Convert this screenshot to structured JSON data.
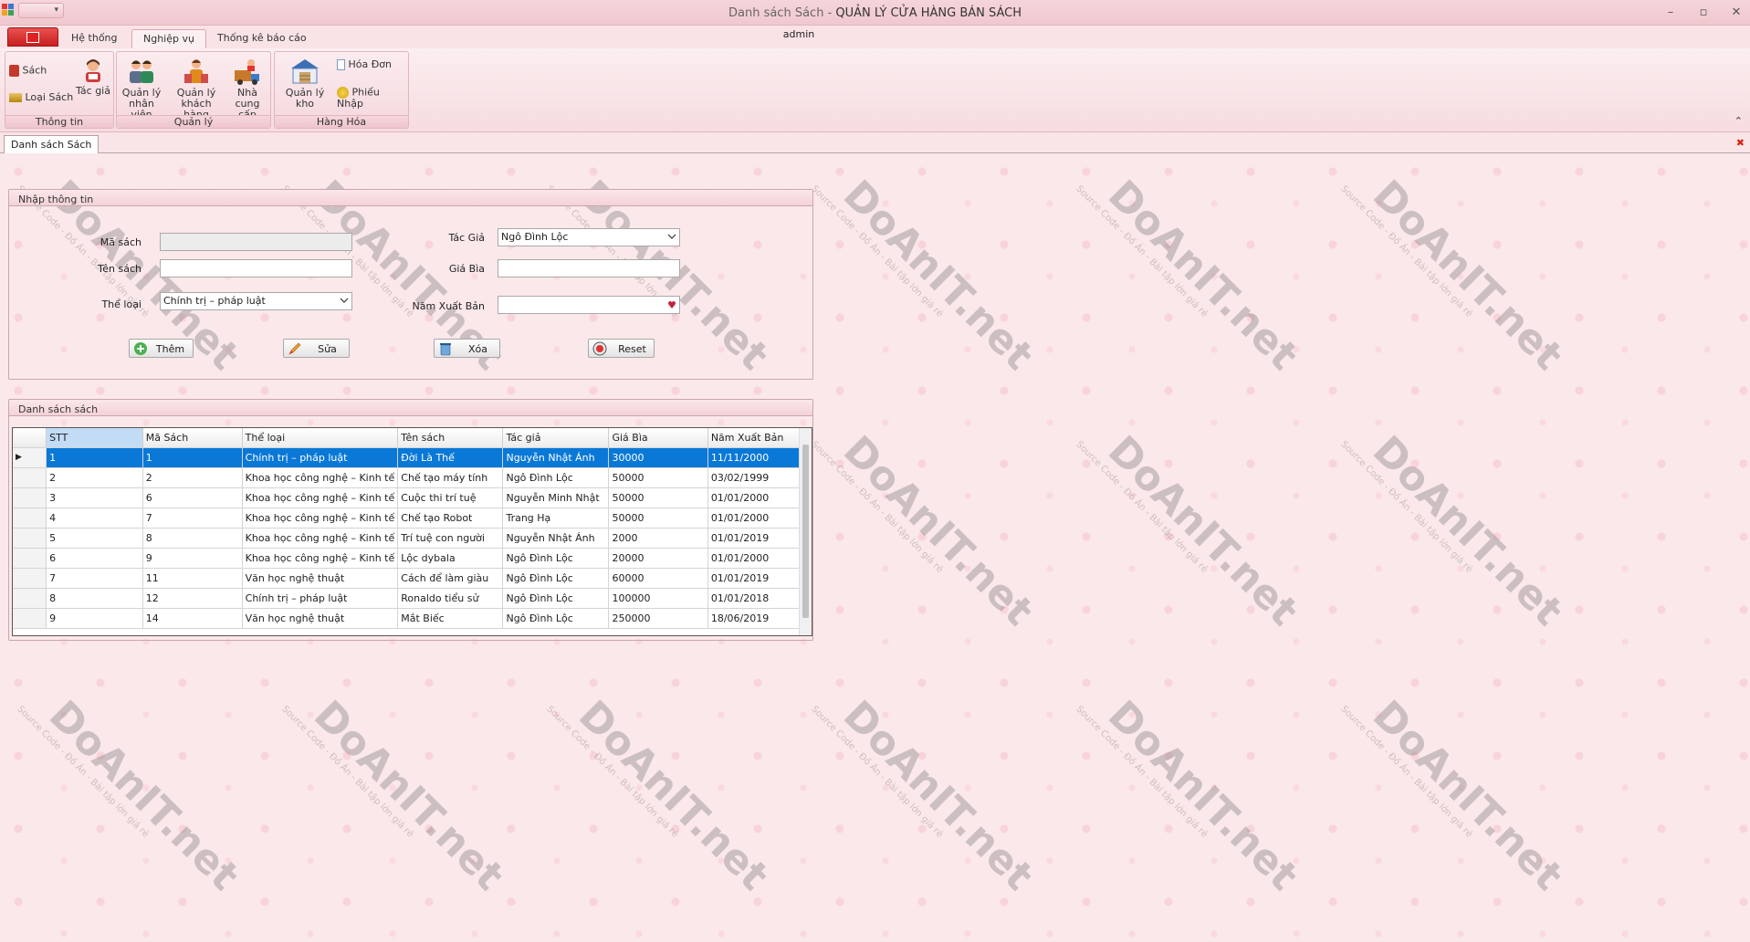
{
  "window": {
    "title_prefix": "Danh sách Sách - ",
    "title_main": "QUẢN LÝ CỬA HÀNG BÁN SÁCH",
    "user": "admin"
  },
  "ribbon": {
    "tabs": [
      {
        "label": "Hệ thống"
      },
      {
        "label": "Nghiệp vụ"
      },
      {
        "label": "Thống kê báo cáo"
      }
    ],
    "groups": {
      "thong_tin": {
        "caption": "Thông tin",
        "sach": "Sách",
        "loai_sach": "Loại Sách",
        "tac_gia": "Tác giả"
      },
      "quan_ly": {
        "caption": "Quản lý",
        "nhan_vien_1": "Quản lý",
        "nhan_vien_2": "nhân viên",
        "khach_hang_1": "Quản lý",
        "khach_hang_2": "khách hàng",
        "ncc_1": "Nhà cung",
        "ncc_2": "cấp"
      },
      "hang_hoa": {
        "caption": "Hàng Hóa",
        "kho": "Quản lý kho",
        "hoa_don": "Hóa Đơn",
        "phieu_nhap": "Phiếu Nhập"
      }
    }
  },
  "doc_tab": "Danh sách Sách",
  "form": {
    "legend": "Nhập thông tin",
    "ma_sach_label": "Mã sách",
    "ma_sach_value": "",
    "ten_sach_label": "Tên sách",
    "ten_sach_value": "",
    "the_loai_label": "Thể loại",
    "the_loai_value": "Chính trị – pháp luật",
    "tac_gia_label": "Tác Giả",
    "tac_gia_value": "Ngô Đình Lộc",
    "gia_bia_label": "Giá Bìa",
    "gia_bia_value": "",
    "nam_xb_label": "Năm Xuất Bản",
    "nam_xb_value": "",
    "buttons": {
      "them": "Thêm",
      "sua": "Sửa",
      "xoa": "Xóa",
      "reset": "Reset"
    }
  },
  "list": {
    "legend": "Danh sách sách",
    "columns": [
      "STT",
      "Mã Sách",
      "Thể loại",
      "Tên sách",
      "Tác giả",
      "Giá Bìa",
      "Năm Xuất Bản"
    ],
    "rows": [
      [
        "1",
        "1",
        "Chính trị – pháp luật",
        "Đời Là Thế",
        "Nguyễn Nhật Ánh",
        "30000",
        "11/11/2000"
      ],
      [
        "2",
        "2",
        "Khoa học công nghệ – Kinh tế",
        "Chế tạo máy tính",
        "Ngô Đình Lộc",
        "50000",
        "03/02/1999"
      ],
      [
        "3",
        "6",
        "Khoa học công nghệ – Kinh tế",
        "Cuộc thi trí tuệ",
        "Nguyễn Minh Nhật",
        "50000",
        "01/01/2000"
      ],
      [
        "4",
        "7",
        "Khoa học công nghệ – Kinh tế",
        "Chế tạo Robot",
        "Trang Hạ",
        "50000",
        "01/01/2000"
      ],
      [
        "5",
        "8",
        "Khoa học công nghệ – Kinh tế",
        "Trí tuệ con người",
        "Nguyễn Nhật Ánh",
        "2000",
        "01/01/2019"
      ],
      [
        "6",
        "9",
        "Khoa học công nghệ – Kinh tế",
        "Lộc dybala",
        "Ngô Đình Lộc",
        "20000",
        "01/01/2000"
      ],
      [
        "7",
        "11",
        "Văn học nghệ thuật",
        "Cách để làm giàu",
        "Ngô Đình Lộc",
        "60000",
        "01/01/2019"
      ],
      [
        "8",
        "12",
        "Chính trị – pháp luật",
        "Ronaldo tiểu sử",
        "Ngô Đình Lộc",
        "100000",
        "01/01/2018"
      ],
      [
        "9",
        "14",
        "Văn học nghệ thuật",
        "Mắt Biếc",
        "Ngô Đình Lộc",
        "250000",
        "18/06/2019"
      ]
    ],
    "selected_row": 0
  },
  "watermark": {
    "brand": "DoAnIT.net",
    "sub": "Source Code - Đồ Án - Bài tập lớn giá rẻ"
  },
  "colors": {
    "selection": "#0a78d7",
    "file_button": "#c81e1e",
    "background": "#fbe8ea"
  }
}
